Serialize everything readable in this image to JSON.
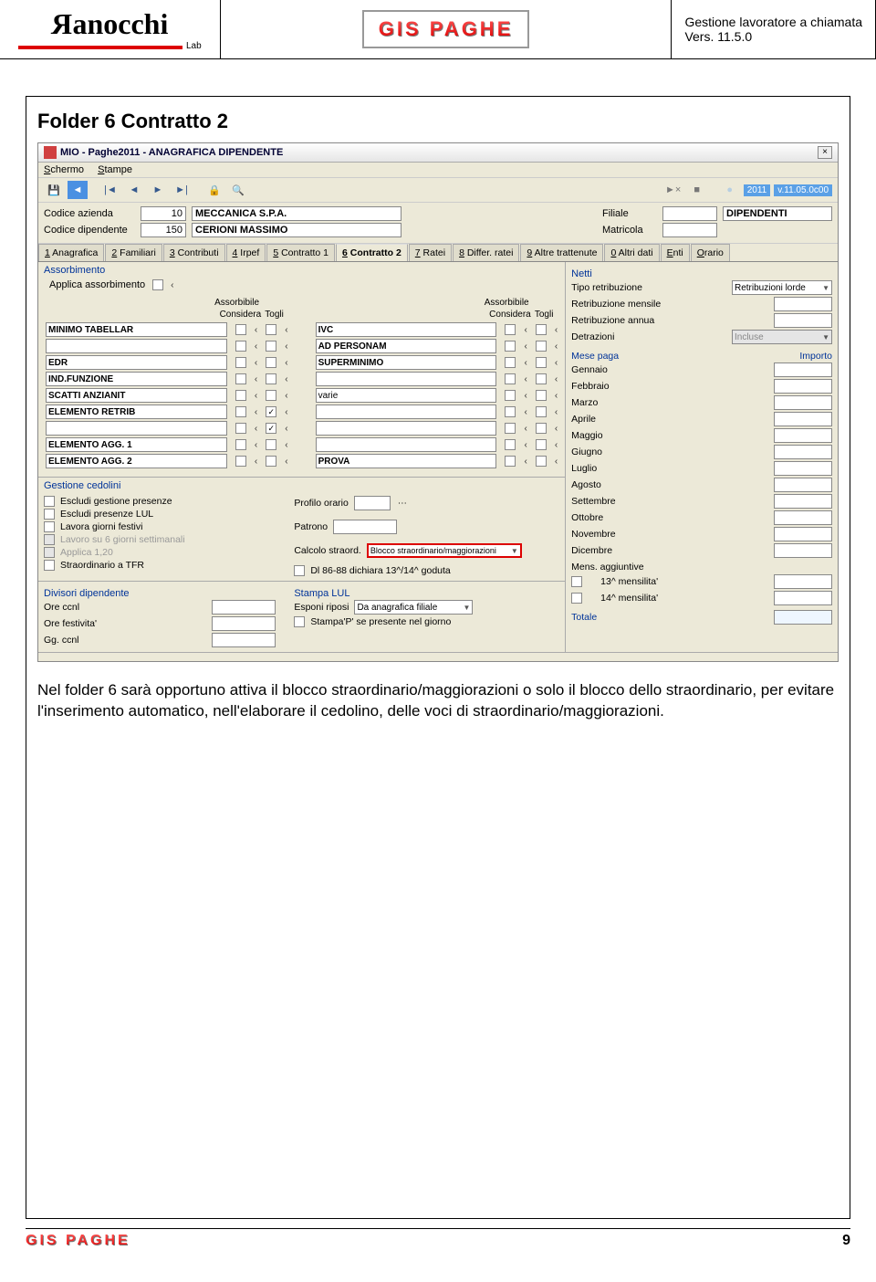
{
  "doc": {
    "brand": "Ranocchi",
    "brand_sub": "Lab",
    "product": "GIS PAGHE",
    "title_line1": "Gestione lavoratore a chiamata",
    "title_line2": "Vers. 11.5.0",
    "section_title": "Folder 6 Contratto 2",
    "body_text": "Nel folder 6 sarà opportuno attiva il blocco straordinario/maggiorazioni o solo il blocco dello straordinario, per evitare l'inserimento automatico, nell'elaborare il cedolino, delle voci di straordinario/maggiorazioni.",
    "page_number": "9"
  },
  "app": {
    "window_title": "MIO - Paghe2011 - ANAGRAFICA DIPENDENTE",
    "menu": {
      "schermo": "Schermo",
      "stampe": "Stampe"
    },
    "toolbar": {
      "year": "2011",
      "version": "v.11.05.0c00"
    },
    "header": {
      "codice_azienda_lbl": "Codice azienda",
      "codice_azienda_val": "10",
      "azienda_nome": "MECCANICA S.P.A.",
      "codice_dip_lbl": "Codice dipendente",
      "codice_dip_val": "150",
      "dip_nome": "CERIONI MASSIMO",
      "filiale_lbl": "Filiale",
      "filiale_val": "DIPENDENTI",
      "matricola_lbl": "Matricola"
    },
    "tabs": [
      {
        "label": "1 Anagrafica"
      },
      {
        "label": "2 Familiari"
      },
      {
        "label": "3 Contributi"
      },
      {
        "label": "4 Irpef"
      },
      {
        "label": "5 Contratto 1"
      },
      {
        "label": "6 Contratto 2",
        "active": true
      },
      {
        "label": "7 Ratei"
      },
      {
        "label": "8 Differ. ratei"
      },
      {
        "label": "9 Altre trattenute"
      },
      {
        "label": "0 Altri dati"
      },
      {
        "label": "Enti"
      },
      {
        "label": "Orario"
      }
    ],
    "assorbimento": {
      "title": "Assorbimento",
      "applica_lbl": "Applica assorbimento",
      "hdr_ass": "Assorbibile",
      "hdr_cons": "Considera",
      "hdr_togli": "Togli",
      "left": [
        {
          "name": "MINIMO TABELLAR",
          "bold": true
        },
        {
          "name": "",
          "bold": false
        },
        {
          "name": "EDR",
          "bold": true
        },
        {
          "name": "IND.FUNZIONE",
          "bold": true
        },
        {
          "name": "SCATTI ANZIANIT",
          "bold": true
        },
        {
          "name": "ELEMENTO RETRIB",
          "bold": true,
          "togli": true
        },
        {
          "name": "",
          "bold": false,
          "togli": true
        },
        {
          "name": "ELEMENTO AGG. 1",
          "bold": true
        },
        {
          "name": "ELEMENTO AGG. 2",
          "bold": true
        }
      ],
      "right": [
        {
          "name": "IVC",
          "bold": true
        },
        {
          "name": "AD PERSONAM",
          "bold": true
        },
        {
          "name": "SUPERMINIMO",
          "bold": true
        },
        {
          "name": "",
          "bold": false
        },
        {
          "name": "varie",
          "bold": false
        },
        {
          "name": "",
          "bold": false
        },
        {
          "name": "",
          "bold": false
        },
        {
          "name": "",
          "bold": false
        },
        {
          "name": "PROVA",
          "bold": true
        }
      ]
    },
    "cedolini": {
      "title": "Gestione cedolini",
      "items": [
        {
          "label": "Escludi gestione presenze"
        },
        {
          "label": "Escludi presenze LUL"
        },
        {
          "label": "Lavora giorni festivi"
        },
        {
          "label": "Lavoro su 6 giorni settimanali",
          "disabled": true
        },
        {
          "label": "Applica 1,20",
          "disabled": true
        },
        {
          "label": "Straordinario a TFR"
        }
      ],
      "profilo_lbl": "Profilo orario",
      "patrono_lbl": "Patrono",
      "calcolo_lbl": "Calcolo straord.",
      "calcolo_val": "Blocco straordinario/maggiorazioni",
      "dl_lbl": "Dl 86-88 dichiara 13^/14^ goduta"
    },
    "divisori": {
      "title": "Divisori dipendente",
      "rows": [
        "Ore ccnl",
        "Ore festivita'",
        "Gg. ccnl"
      ],
      "stampa_title": "Stampa LUL",
      "esponi_lbl": "Esponi riposi",
      "esponi_val": "Da anagrafica filiale",
      "stampap_lbl": "Stampa'P' se presente nel giorno"
    },
    "netti": {
      "title": "Netti",
      "tipo_lbl": "Tipo retribuzione",
      "tipo_val": "Retribuzioni lorde",
      "mens_lbl": "Retribuzione mensile",
      "annua_lbl": "Retribuzione annua",
      "detr_lbl": "Detrazioni",
      "detr_val": "Incluse",
      "mese_hdr": "Mese paga",
      "importo_hdr": "Importo",
      "mesi": [
        "Gennaio",
        "Febbraio",
        "Marzo",
        "Aprile",
        "Maggio",
        "Giugno",
        "Luglio",
        "Agosto",
        "Settembre",
        "Ottobre",
        "Novembre",
        "Dicembre"
      ],
      "mens_agg": "Mens. aggiuntive",
      "m13": "13^ mensilita'",
      "m14": "14^ mensilita'",
      "totale": "Totale"
    }
  }
}
